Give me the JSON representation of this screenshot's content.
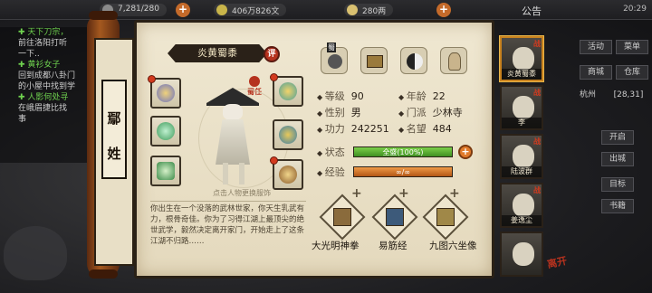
{
  "topbar": {
    "res1": "7,281/280",
    "res2": "406万826文",
    "res3": "280两",
    "notice": "公告",
    "time": "20:29"
  },
  "quest_panel": {
    "lines": [
      {
        "text": "天下刀宗，",
        "head": true
      },
      {
        "text": "前往洛阳打听",
        "head": false
      },
      {
        "text": "一下..",
        "head": false
      },
      {
        "text": "黄衫女子",
        "head": true
      },
      {
        "text": "回到成都八卦门",
        "head": false
      },
      {
        "text": "的小屋中找到学",
        "head": false
      },
      {
        "text": "人影何处寻",
        "head": true
      },
      {
        "text": "在峨眉捷比找",
        "head": false
      },
      {
        "text": "事",
        "head": false
      }
    ]
  },
  "right_menu": [
    "活动",
    "菜单",
    "商城",
    "仓库",
    "杭州",
    "[28,31]",
    "开启",
    "出城",
    "目标",
    "书籍"
  ],
  "character": {
    "surname": [
      "鄢",
      "姓"
    ],
    "title": "炎黄蜀黍",
    "eval_label": "评",
    "tag": "蜀任",
    "hint": "点击人物更换服饰",
    "kungfu_badge": "蜀"
  },
  "stats": {
    "level_k": "等级",
    "level_v": "90",
    "age_k": "年龄",
    "age_v": "22",
    "gender_k": "性别",
    "gender_v": "男",
    "sect_k": "门派",
    "sect_v": "少林寺",
    "power_k": "功力",
    "power_v": "242251",
    "fame_k": "名望",
    "fame_v": "484",
    "state_k": "状态",
    "state_v": "全盛(100%)",
    "state_pct": 100,
    "exp_k": "经验",
    "exp_v": "∞/∞",
    "exp_pct": 100
  },
  "bio": "你出生在一个没落的武林世家，你天生乳武有力，根骨奇佳。你为了习得江湖上最顶尖的绝世武学，毅然决定离开家门，开始走上了这条江湖不归路……",
  "techniques": [
    {
      "name": "大光明神拳"
    },
    {
      "name": "易筋经"
    },
    {
      "name": "九图六坐像"
    }
  ],
  "companions": [
    {
      "name": "炎黄蜀黍",
      "flag": "战",
      "selected": true
    },
    {
      "name": "李",
      "flag": "战",
      "selected": false
    },
    {
      "name": "陆波群",
      "flag": "战",
      "selected": false
    },
    {
      "name": "姜逸尘",
      "flag": "战",
      "selected": false
    },
    {
      "name": "",
      "flag": "",
      "selected": false
    }
  ],
  "leave_label": "离开",
  "colors": {
    "paper": "#e9e0c8",
    "accent_red": "#b5321e",
    "state_bar": "#58b232",
    "exp_bar": "#d7782a",
    "rod": "#a4581f"
  }
}
